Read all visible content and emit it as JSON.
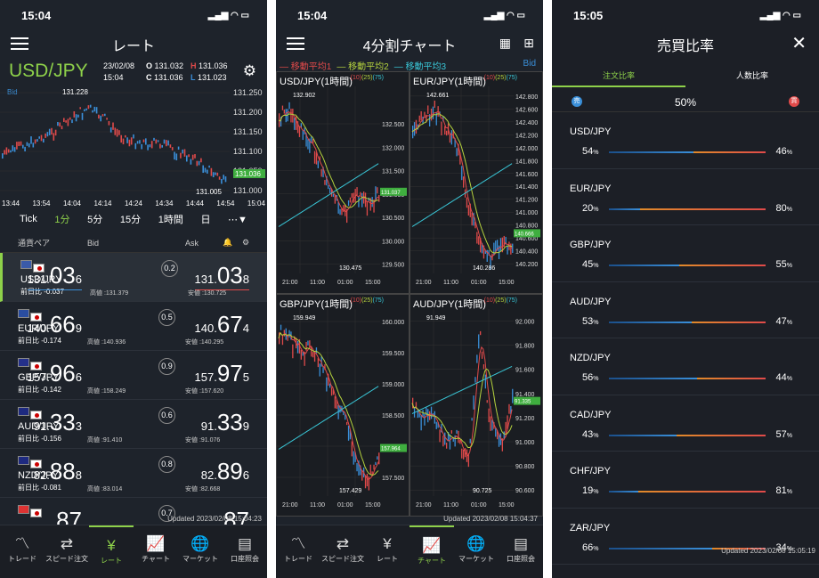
{
  "colors": {
    "accent": "#8ed14a",
    "buy": "#e04a4a",
    "sell": "#3a8fd9"
  },
  "p1": {
    "time": "15:04",
    "title": "レート",
    "pair": "USD/JPY",
    "date": "23/02/08",
    "clock": "15:04",
    "o_lbl": "O",
    "o": "131.032",
    "h_lbl": "H",
    "h": "131.036",
    "c_lbl": "C",
    "c": "131.036",
    "l_lbl": "L",
    "l": "131.023",
    "bid_lbl": "Bid",
    "chart_high": "131.228",
    "chart_low": "131.005",
    "last": "131.036",
    "yticks": [
      "131.250",
      "131.200",
      "131.150",
      "131.100",
      "131.050",
      "131.000"
    ],
    "xticks": [
      "13:44",
      "13:54",
      "14:04",
      "14:14",
      "14:24",
      "14:34",
      "14:44",
      "14:54",
      "15:04"
    ],
    "periods": [
      "Tick",
      "1分",
      "5分",
      "15分",
      "1時間",
      "日",
      "⋯▼"
    ],
    "head_pair": "通貨ペア",
    "head_bid": "Bid",
    "head_ask": "Ask",
    "rows": [
      {
        "name": "USD/JPY",
        "chg_lbl": "前日比",
        "chg": "-0.037",
        "bid_a": "131.",
        "bid_b": "03",
        "bid_c": "6",
        "ask_a": "131.",
        "ask_b": "03",
        "ask_c": "8",
        "spread": "0.2",
        "hi_lbl": "高値",
        "hi": "131.379",
        "lo_lbl": "安値",
        "lo": "130.725"
      },
      {
        "name": "EUR/JPY",
        "chg_lbl": "前日比",
        "chg": "-0.174",
        "bid_a": "140.",
        "bid_b": "66",
        "bid_c": "9",
        "ask_a": "140.",
        "ask_b": "67",
        "ask_c": "4",
        "spread": "0.5",
        "hi_lbl": "高値",
        "hi": "140.936",
        "lo_lbl": "安値",
        "lo": "140.295"
      },
      {
        "name": "GBP/JPY",
        "chg_lbl": "前日比",
        "chg": "-0.142",
        "bid_a": "157.",
        "bid_b": "96",
        "bid_c": "6",
        "ask_a": "157.",
        "ask_b": "97",
        "ask_c": "5",
        "spread": "0.9",
        "hi_lbl": "高値",
        "hi": "158.249",
        "lo_lbl": "安値",
        "lo": "157.620"
      },
      {
        "name": "AUD/JPY",
        "chg_lbl": "前日比",
        "chg": "-0.156",
        "bid_a": "91.",
        "bid_b": "33",
        "bid_c": "3",
        "ask_a": "91.",
        "ask_b": "33",
        "ask_c": "9",
        "spread": "0.6",
        "hi_lbl": "高値",
        "hi": "91.410",
        "lo_lbl": "安値",
        "lo": "91.076"
      },
      {
        "name": "NZD/JPY",
        "chg_lbl": "前日比",
        "chg": "-0.081",
        "bid_a": "82.",
        "bid_b": "88",
        "bid_c": "8",
        "ask_a": "82.",
        "ask_b": "89",
        "ask_c": "6",
        "spread": "0.8",
        "hi_lbl": "高値",
        "hi": "83.014",
        "lo_lbl": "安値",
        "lo": "82.668"
      },
      {
        "name": "",
        "chg_lbl": "",
        "chg": "",
        "bid_a": "",
        "bid_b": "87",
        "bid_c": "",
        "ask_a": "",
        "ask_b": "87",
        "ask_c": "",
        "spread": "0.7",
        "hi_lbl": "",
        "hi": "",
        "lo_lbl": "",
        "lo": ""
      }
    ],
    "updated": "Updated  2023/02/08 15:04:23"
  },
  "tabs": [
    {
      "label": "トレード",
      "icon": "〽"
    },
    {
      "label": "スピード注文",
      "icon": "⇄"
    },
    {
      "label": "レート",
      "icon": "¥"
    },
    {
      "label": "チャート",
      "icon": "📈"
    },
    {
      "label": "マーケット",
      "icon": "🌐"
    },
    {
      "label": "口座照会",
      "icon": "▤"
    }
  ],
  "p2": {
    "time": "15:04",
    "title": "4分割チャート",
    "ma1": "— 移動平均1",
    "ma2": "— 移動平均2",
    "ma3": "— 移動平均3",
    "bid": "Bid",
    "ma_a": "(10)",
    "ma_b": "(25)",
    "ma_c": "(75)",
    "updated": "Updated  2023/02/08 15:04:37",
    "xticks": [
      "21:00",
      "11:00",
      "01:00",
      "15:00"
    ]
  },
  "chart_data": [
    {
      "type": "line",
      "title": "USD/JPY(1時間)",
      "hi": "132.902",
      "lo": "130.475",
      "last": "131.037",
      "yticks": [
        "132.500",
        "132.000",
        "131.500",
        "131.000",
        "130.500",
        "130.000",
        "129.500"
      ],
      "x": [
        "21:00",
        "11:00",
        "01:00",
        "15:00"
      ],
      "ylim": [
        129.3,
        133.3
      ]
    },
    {
      "type": "line",
      "title": "EUR/JPY(1時間)",
      "hi": "142.661",
      "lo": "140.286",
      "last": "140.666",
      "yticks": [
        "142.800",
        "142.600",
        "142.400",
        "142.200",
        "142.000",
        "141.800",
        "141.600",
        "141.400",
        "141.200",
        "141.000",
        "140.800",
        "140.600",
        "140.400",
        "140.200"
      ],
      "x": [
        "21:00",
        "11:00",
        "01:00",
        "15:00"
      ],
      "ylim": [
        140.05,
        142.95
      ]
    },
    {
      "type": "line",
      "title": "GBP/JPY(1時間)",
      "hi": "159.949",
      "lo": "157.429",
      "last": "157.964",
      "yticks": [
        "160.000",
        "159.500",
        "159.000",
        "158.500",
        "158.000",
        "157.500"
      ],
      "x": [
        "21:00",
        "11:00",
        "01:00",
        "15:00"
      ],
      "ylim": [
        157.2,
        160.2
      ]
    },
    {
      "type": "line",
      "title": "AUD/JPY(1時間)",
      "hi": "91.949",
      "lo": "90.725",
      "last": "91.335",
      "yticks": [
        "92.000",
        "91.800",
        "91.600",
        "91.400",
        "91.200",
        "91.000",
        "90.800",
        "90.600"
      ],
      "x": [
        "21:00",
        "11:00",
        "01:00",
        "15:00"
      ],
      "ylim": [
        90.55,
        92.1
      ]
    }
  ],
  "p3": {
    "time": "15:05",
    "title": "売買比率",
    "tab_order": "注文比率",
    "tab_people": "人数比率",
    "sell_dot": "売",
    "buy_dot": "買",
    "center": "50%",
    "pct": "%",
    "rows": [
      {
        "name": "USD/JPY",
        "sell": "54",
        "buy": "46",
        "ratio": 0.54
      },
      {
        "name": "EUR/JPY",
        "sell": "20",
        "buy": "80",
        "ratio": 0.2
      },
      {
        "name": "GBP/JPY",
        "sell": "45",
        "buy": "55",
        "ratio": 0.45
      },
      {
        "name": "AUD/JPY",
        "sell": "53",
        "buy": "47",
        "ratio": 0.53
      },
      {
        "name": "NZD/JPY",
        "sell": "56",
        "buy": "44",
        "ratio": 0.56
      },
      {
        "name": "CAD/JPY",
        "sell": "43",
        "buy": "57",
        "ratio": 0.43
      },
      {
        "name": "CHF/JPY",
        "sell": "19",
        "buy": "81",
        "ratio": 0.19
      },
      {
        "name": "ZAR/JPY",
        "sell": "66",
        "buy": "34",
        "ratio": 0.66
      }
    ],
    "updated": "Updated  2023/02/08 15:05:19"
  }
}
